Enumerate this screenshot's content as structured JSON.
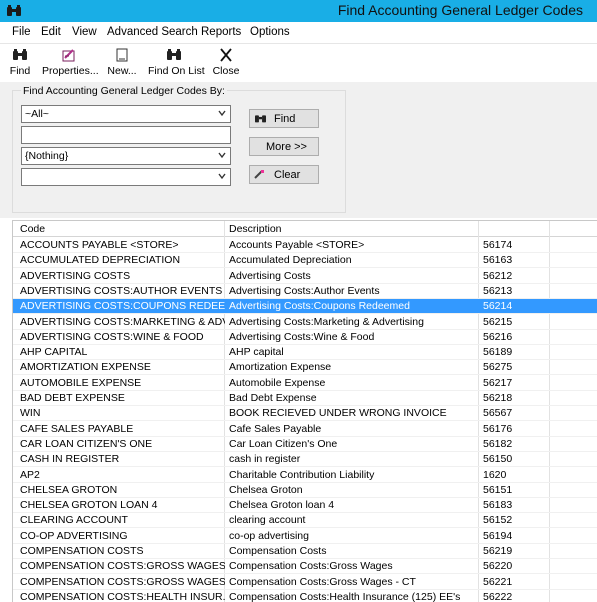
{
  "window": {
    "title": "Find Accounting General Ledger Codes",
    "icon": "binoculars-icon"
  },
  "menu": [
    "File",
    "Edit",
    "View",
    "Advanced Search",
    "Reports",
    "Options"
  ],
  "toolbar": [
    {
      "label": "Find",
      "icon": "binoculars-icon"
    },
    {
      "label": "Properties...",
      "icon": "properties-icon"
    },
    {
      "label": "New...",
      "icon": "new-document-icon"
    },
    {
      "label": "Find On List",
      "icon": "binoculars-icon"
    },
    {
      "label": "Close",
      "icon": "close-icon"
    }
  ],
  "search": {
    "group_label": "Find Accounting General Ledger Codes By:",
    "field1_value": "~All~",
    "field2_value": "",
    "field3_value": "{Nothing}",
    "field4_value": "",
    "find_label": "Find",
    "more_label": "More >>",
    "clear_label": "Clear"
  },
  "grid": {
    "columns": [
      "Code",
      "Description",
      ""
    ],
    "selected_index": 4,
    "rows": [
      {
        "code": "ACCOUNTS PAYABLE <STORE>",
        "desc": "Accounts Payable <STORE>",
        "num": "56174"
      },
      {
        "code": "ACCUMULATED DEPRECIATION",
        "desc": "Accumulated Depreciation",
        "num": "56163"
      },
      {
        "code": "ADVERTISING COSTS",
        "desc": "Advertising Costs",
        "num": "56212"
      },
      {
        "code": "ADVERTISING COSTS:AUTHOR EVENTS",
        "desc": "Advertising Costs:Author Events",
        "num": "56213"
      },
      {
        "code": "ADVERTISING COSTS:COUPONS REDEE...",
        "desc": "Advertising Costs:Coupons Redeemed",
        "num": "56214"
      },
      {
        "code": "ADVERTISING COSTS:MARKETING & ADV...",
        "desc": "Advertising Costs:Marketing & Advertising",
        "num": "56215"
      },
      {
        "code": "ADVERTISING COSTS:WINE & FOOD",
        "desc": "Advertising Costs:Wine & Food",
        "num": "56216"
      },
      {
        "code": "AHP CAPITAL",
        "desc": "AHP capital",
        "num": "56189"
      },
      {
        "code": "AMORTIZATION EXPENSE",
        "desc": "Amortization Expense",
        "num": "56275"
      },
      {
        "code": "AUTOMOBILE EXPENSE",
        "desc": "Automobile Expense",
        "num": "56217"
      },
      {
        "code": "BAD DEBT EXPENSE",
        "desc": "Bad Debt Expense",
        "num": "56218"
      },
      {
        "code": "WIN",
        "desc": "BOOK RECIEVED UNDER WRONG INVOICE",
        "num": "56567"
      },
      {
        "code": "CAFE SALES PAYABLE",
        "desc": "Cafe Sales Payable",
        "num": "56176"
      },
      {
        "code": "CAR LOAN CITIZEN'S ONE",
        "desc": "Car Loan Citizen's One",
        "num": "56182"
      },
      {
        "code": "CASH IN REGISTER",
        "desc": "cash in register",
        "num": "56150"
      },
      {
        "code": "AP2",
        "desc": "Charitable Contribution Liability",
        "num": "1620"
      },
      {
        "code": "CHELSEA GROTON",
        "desc": "Chelsea Groton",
        "num": "56151"
      },
      {
        "code": "CHELSEA GROTON LOAN 4",
        "desc": "Chelsea Groton loan 4",
        "num": "56183"
      },
      {
        "code": "CLEARING ACCOUNT",
        "desc": "clearing account",
        "num": "56152"
      },
      {
        "code": "CO-OP ADVERTISING",
        "desc": "co-op advertising",
        "num": "56194"
      },
      {
        "code": "COMPENSATION COSTS",
        "desc": "Compensation Costs",
        "num": "56219"
      },
      {
        "code": "COMPENSATION COSTS:GROSS WAGES",
        "desc": "Compensation Costs:Gross Wages",
        "num": "56220"
      },
      {
        "code": "COMPENSATION COSTS:GROSS WAGES ...",
        "desc": "Compensation Costs:Gross Wages - CT",
        "num": "56221"
      },
      {
        "code": "COMPENSATION COSTS:HEALTH INSUR...",
        "desc": "Compensation Costs:Health Insurance (125) EE's",
        "num": "56222"
      }
    ]
  }
}
